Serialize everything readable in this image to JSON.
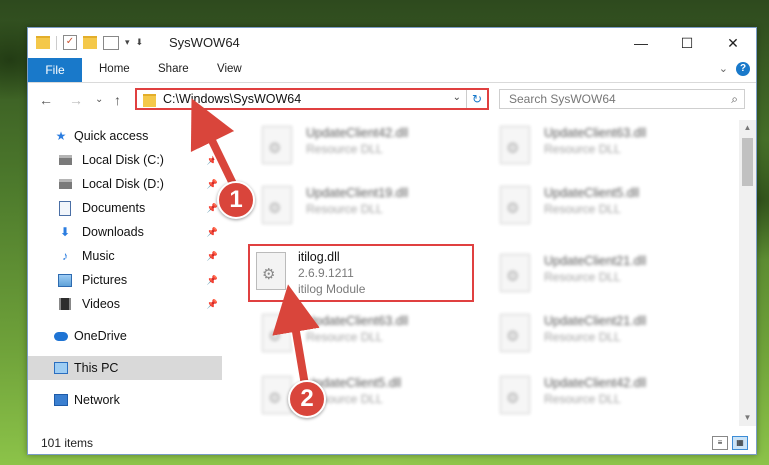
{
  "window": {
    "title": "SysWOW64",
    "controls": {
      "minimize": "—",
      "maximize": "☐",
      "close": "✕"
    }
  },
  "ribbon": {
    "tabs": [
      "File",
      "Home",
      "Share",
      "View"
    ],
    "help": "?",
    "collapse": "⌄"
  },
  "nav": {
    "back": "←",
    "forward": "→",
    "recent": "⌄",
    "up": "↑",
    "address": "C:\\Windows\\SysWOW64",
    "address_dropdown": "⌄",
    "refresh": "↻",
    "search_placeholder": "Search SysWOW64",
    "search_icon": "⌕"
  },
  "sidebar": {
    "items": [
      {
        "label": "Quick access",
        "icon": "star-icon",
        "pinned": false
      },
      {
        "label": "Local Disk (C:)",
        "icon": "drive-icon",
        "pinned": true
      },
      {
        "label": "Local Disk (D:)",
        "icon": "drive-icon",
        "pinned": true
      },
      {
        "label": "Documents",
        "icon": "documents-icon",
        "pinned": true
      },
      {
        "label": "Downloads",
        "icon": "download-icon",
        "pinned": true
      },
      {
        "label": "Music",
        "icon": "music-icon",
        "pinned": true
      },
      {
        "label": "Pictures",
        "icon": "pictures-icon",
        "pinned": true
      },
      {
        "label": "Videos",
        "icon": "videos-icon",
        "pinned": true
      },
      {
        "label": "OneDrive",
        "icon": "cloud-icon",
        "pinned": false
      },
      {
        "label": "This PC",
        "icon": "computer-icon",
        "pinned": false,
        "selected": true
      },
      {
        "label": "Network",
        "icon": "network-icon",
        "pinned": false
      }
    ]
  },
  "files": [
    {
      "name": "UpdateClient42.dll",
      "line2": "Resource DLL"
    },
    {
      "name": "UpdateClient63.dll",
      "line2": "Resource DLL"
    },
    {
      "name": "UpdateClient19.dll",
      "line2": "Resource DLL"
    },
    {
      "name": "UpdateClient5.dll",
      "line2": "Resource DLL"
    },
    {
      "name": "itilog.dll",
      "line2": "2.6.9.1211",
      "line3": "itilog Module",
      "highlighted": true
    },
    {
      "name": "UpdateClient21.dll",
      "line2": "Resource DLL"
    },
    {
      "name": "UpdateClient63.dll",
      "line2": "Resource DLL"
    },
    {
      "name": "UpdateClient21.dll",
      "line2": "Resource DLL"
    },
    {
      "name": "UpdateClient5.dll",
      "line2": "Resource DLL"
    },
    {
      "name": "UpdateClient42.dll",
      "line2": "Resource DLL"
    }
  ],
  "status": {
    "item_count": "101 items"
  },
  "annotations": {
    "step1": "1",
    "step2": "2",
    "color": "#d9453b"
  }
}
